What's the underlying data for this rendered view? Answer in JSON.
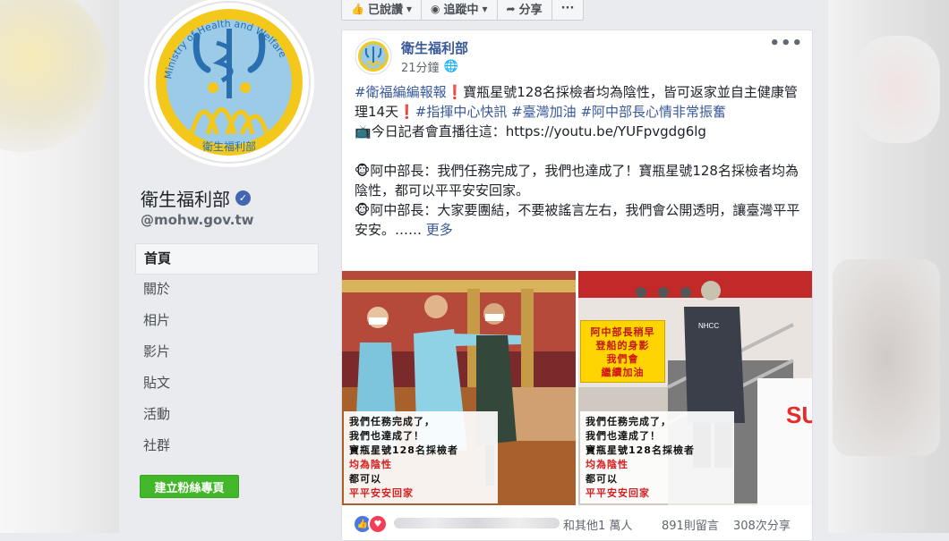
{
  "page": {
    "name": "衛生福利部",
    "handle": "@mohw.gov.tw",
    "logo_text_en": "Ministry of Health and Welfare",
    "logo_text_zh": "衛生福利部"
  },
  "nav": [
    {
      "label": "首頁",
      "active": true
    },
    {
      "label": "關於"
    },
    {
      "label": "相片"
    },
    {
      "label": "影片"
    },
    {
      "label": "貼文"
    },
    {
      "label": "活動"
    },
    {
      "label": "社群"
    }
  ],
  "create_page_button": "建立粉絲專頁",
  "top_actions": {
    "liked": "已說讚",
    "following": "追蹤中",
    "share": "分享",
    "more": "···"
  },
  "post": {
    "author": "衛生福利部",
    "time": "21分鐘",
    "more": "•••",
    "p1_tag": "#衛福編編報報",
    "p1_a": "寶瓶星號128名採檢者均為陰性，皆可返家並自主健康管理14天",
    "p1_tags": "#指揮中心快訊 #臺灣加油 #阿中部長心情非常振奮",
    "p2": "今日記者會直播往這：https://youtu.be/YUFpvgdg6lg",
    "p3": "阿中部長：我們任務完成了，我們也達成了！寶瓶星號128名採檢者均為陰性，都可以平平安安回家。",
    "p4": "阿中部長：大家要團結，不要被謠言左右，我們會公開透明，讓臺灣平平安安。……",
    "see_more": "更多"
  },
  "photo1_caption": {
    "l1": "我們任務完成了，",
    "l2": "我們也達成了！",
    "l3": "寶瓶星號128名採檢者",
    "l4": "均為陰性",
    "l5": "都可以",
    "l6": "平平安安回家"
  },
  "photo2_sign": {
    "l1": "阿中部長稍早",
    "l2": "登船的身影",
    "l3": "我們會",
    "l4": "繼續加油"
  },
  "photo2_vest": "NHCC",
  "photo2_hull": "SU",
  "reactions": {
    "others": "和其他1 萬人",
    "comments": "891則留言",
    "shares": "308次分享"
  }
}
